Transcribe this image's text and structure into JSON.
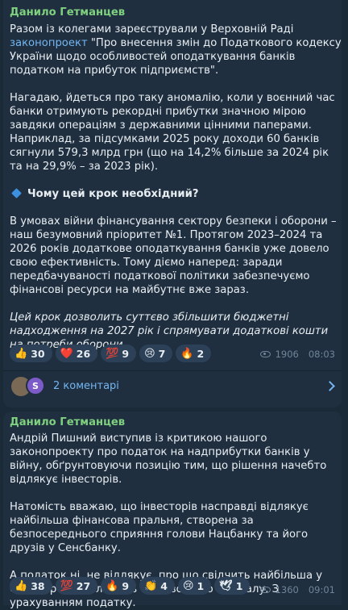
{
  "message1": {
    "author": "Данило Гетманцев",
    "para1_prefix": "Разом із колегами зареєстрували у Верховній Раді ",
    "para1_link": "законопроект",
    "para1_suffix": " \"Про внесення змін до Податкового кодексу України щодо особливостей оподаткування банків податком на прибуток підприємств\".",
    "para2": "Нагадаю, йдеться про таку аномалію, коли у воєнний час банки отримують рекордні прибутки значною мірою завдяки операціям з державними цінними паперами. Наприклад, за підсумками 2025 року доходи 60 банків сягнули 579,3 млрд грн (що на 14,2% більше за 2024 рік та на 29,9% – за 2023 рік).",
    "heading": "Чому цей крок необхідний?",
    "para3": "В умовах війни фінансування сектору безпеки і оборони – наш безумовний пріоритет №1. Протягом 2023–2024 та 2026 років додаткове оподаткування банків уже довело свою ефективність. Тому діємо наперед: заради передбачуваності податкової політики забезпечуємо фінансові ресурси на майбутнє вже зараз.",
    "para4": "Цей крок дозволить суттєво збільшити бюджетні надходження на 2027 рік і спрямувати додаткові кошти на потреби оборони.",
    "reactions": [
      {
        "emoji": "👍",
        "icon": "thumbs-up-icon",
        "count": "30"
      },
      {
        "emoji": "❤️",
        "icon": "heart-icon",
        "count": "26"
      },
      {
        "emoji": "💯",
        "icon": "hundred-icon",
        "count": "9"
      },
      {
        "emoji": "😢",
        "icon": "crying-face-icon",
        "count": "7"
      },
      {
        "emoji": "🔥",
        "icon": "fire-icon",
        "count": "2"
      }
    ],
    "views": "1906",
    "time": "08:03",
    "comments_label": "2 коментарі",
    "avatar_letter": "S"
  },
  "message2": {
    "author": "Данило Гетманцев",
    "para1": "Андрій Пишний виступив із критикою нашого законопроекту про податок на надприбутки банків у війну, обґрунтовуючи позицію тим, що рішення начебто відлякує інвесторів.",
    "para2": "Натомість вважаю, що інвесторів насправді відлякує найбільша фінансова пральня, створена за безпосереднього сприяння голови Нацбанку та його друзів у Сенсбанку.",
    "para3": "А податок ні, не відлякує, про що свідчить найбільша у Європі рентабельність банківського капіталу. З урахуванням податку.",
    "reactions": [
      {
        "emoji": "👍",
        "icon": "thumbs-up-icon",
        "count": "38"
      },
      {
        "emoji": "💯",
        "icon": "hundred-icon",
        "count": "27"
      },
      {
        "emoji": "🔥",
        "icon": "fire-icon",
        "count": "9"
      },
      {
        "emoji": "👏",
        "icon": "clapping-hands-icon",
        "count": "4"
      },
      {
        "emoji": "😢",
        "icon": "crying-face-icon",
        "count": "1"
      },
      {
        "emoji": "🕊",
        "icon": "dove-icon",
        "count": "1"
      }
    ],
    "views": "1360",
    "time": "09:01"
  }
}
